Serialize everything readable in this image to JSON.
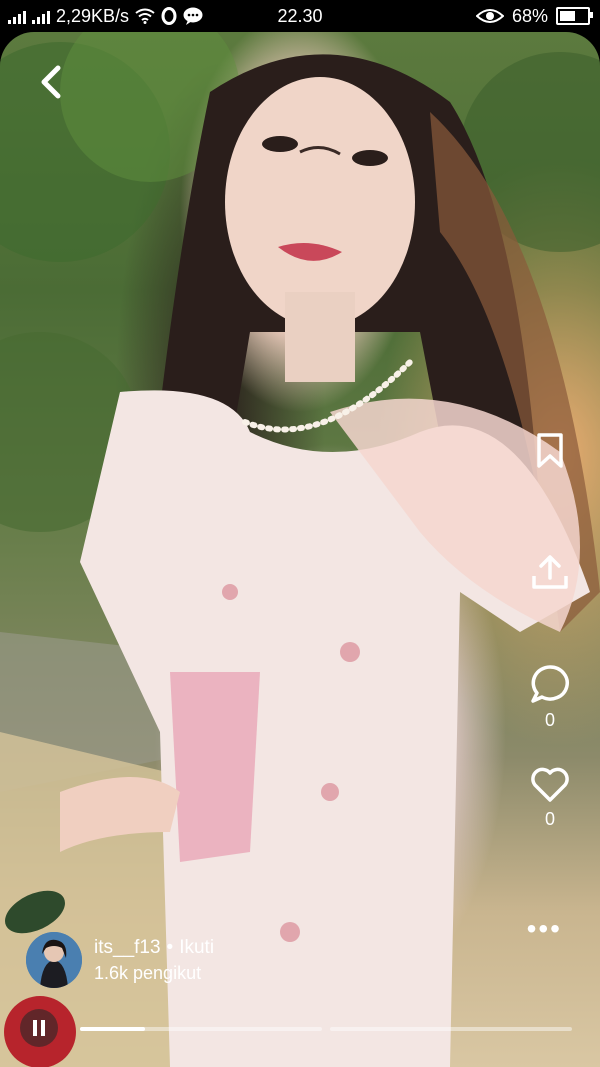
{
  "status_bar": {
    "network_speed": "2,29KB/s",
    "time": "22.30",
    "battery_percent": "68%",
    "battery_level": 0.68,
    "icons": [
      "signal-icon",
      "signal-icon",
      "wifi-icon",
      "opera-icon",
      "chat-icon",
      "eye-icon",
      "battery-icon"
    ]
  },
  "post": {
    "username": "its__f13",
    "separator": "•",
    "follow_label": "Ikuti",
    "followers": "1.6k pengikut",
    "comment_count": "0",
    "like_count": "0"
  },
  "player": {
    "segments": [
      0.27,
      0
    ]
  },
  "actions": [
    "bookmark-icon",
    "share-icon",
    "comment-icon",
    "heart-icon",
    "more-icon"
  ],
  "colors": {
    "icon": "#ffffff",
    "avatar_bg": "#4a7fb0"
  }
}
